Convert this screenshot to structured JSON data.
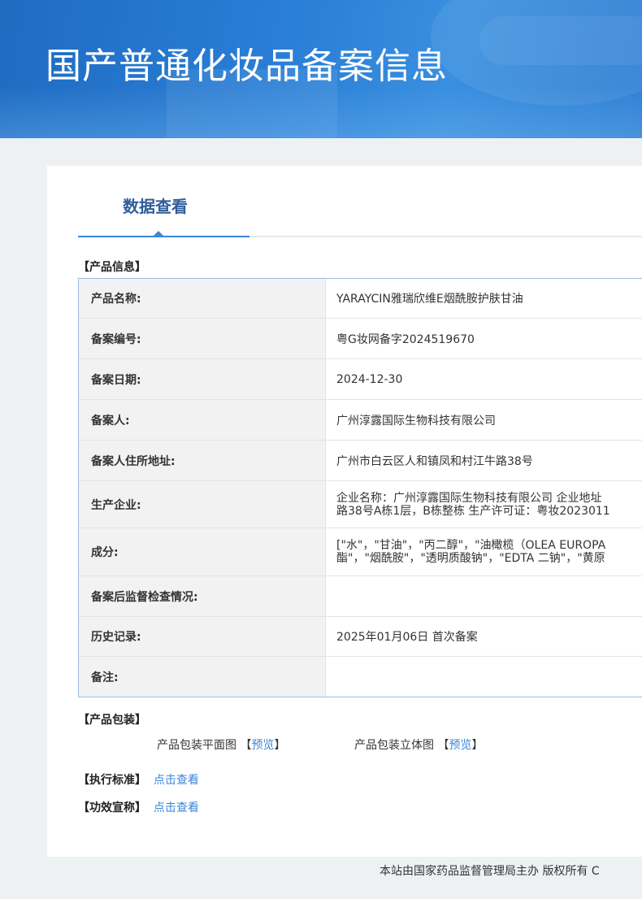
{
  "banner": {
    "title": "国产普通化妆品备案信息"
  },
  "tabs": [
    {
      "label": "数据查看"
    }
  ],
  "product_info": {
    "section_title": "【产品信息】",
    "rows": [
      {
        "label": "产品名称:",
        "value": "YARAYCIN雅瑞欣维E烟酰胺护肤甘油"
      },
      {
        "label": "备案编号:",
        "value": "粤G妆网备字2024519670"
      },
      {
        "label": "备案日期:",
        "value": "2024-12-30"
      },
      {
        "label": "备案人:",
        "value": "广州淳露国际生物科技有限公司"
      },
      {
        "label": "备案人住所地址:",
        "value": "广州市白云区人和镇凤和村江牛路38号"
      },
      {
        "label": "生产企业:",
        "value_line1": "企业名称：广州淳露国际生物科技有限公司 企业地址",
        "value_line2": "路38号A栋1层，B栋整栋 生产许可证：粤妆2023011"
      },
      {
        "label": "成分:",
        "value_line1": "[\"水\"，\"甘油\"，\"丙二醇\"，\"油橄榄（OLEA EUROPA",
        "value_line2": "酯\"，\"烟酰胺\"，\"透明质酸钠\"，\"EDTA 二钠\"，\"黄原"
      },
      {
        "label": "备案后监督检查情况:",
        "value": ""
      },
      {
        "label": "历史记录:",
        "value": "2025年01月06日 首次备案"
      },
      {
        "label": "备注:",
        "value": ""
      }
    ]
  },
  "packaging": {
    "section_title": "【产品包装】",
    "flat_label": "产品包装平面图",
    "flat_link": "预览",
    "solid_label": "产品包装立体图",
    "solid_link": "预览"
  },
  "standard": {
    "section_title": "【执行标准】",
    "link": "点击查看"
  },
  "efficacy": {
    "section_title": "【功效宣称】",
    "link": "点击查看"
  },
  "footer": {
    "text": "本站由国家药品监督管理局主办 版权所有 C"
  },
  "colors": {
    "banner": "#2a7fd6",
    "accent": "#3a86d8",
    "tab_text": "#2f5d9a",
    "label_bg": "#f2f2f2",
    "table_border": "#9dbbe3"
  }
}
